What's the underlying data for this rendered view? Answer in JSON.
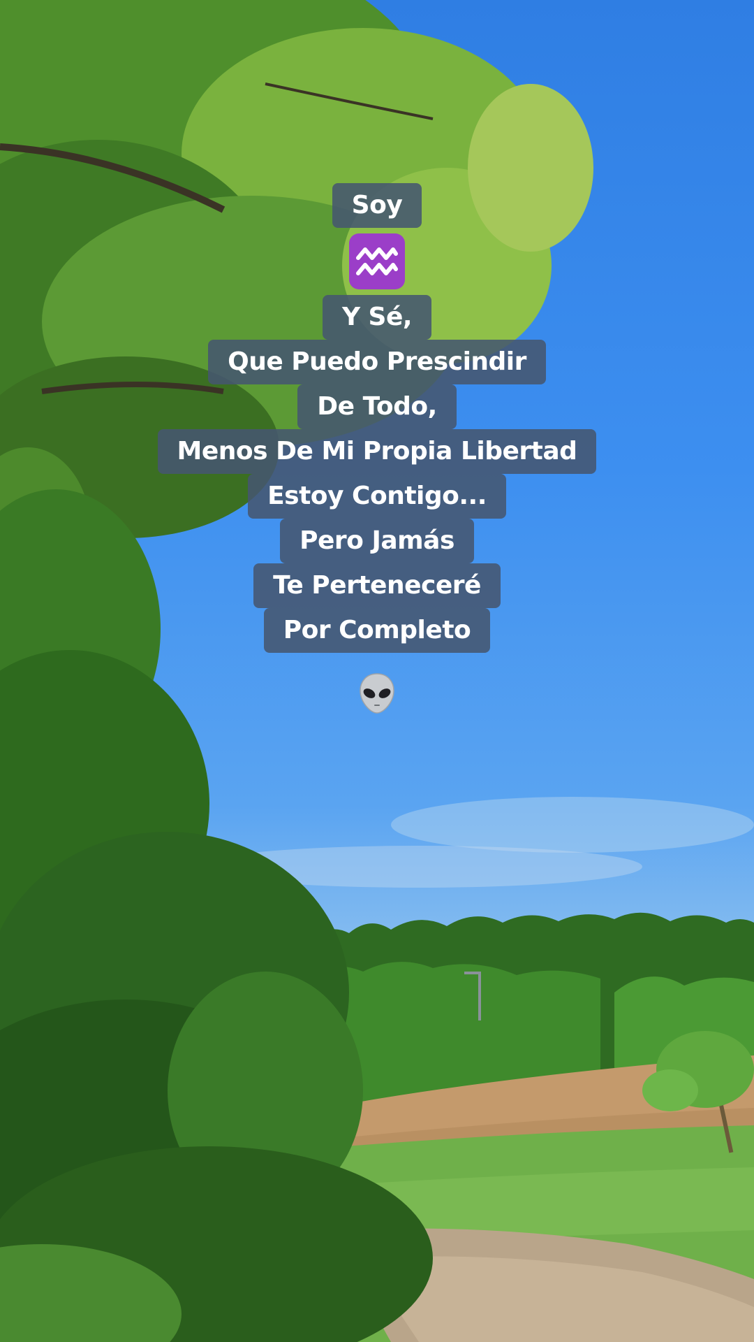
{
  "caption": {
    "lines": [
      "Soy",
      "Y Sé,",
      "Que Puedo Prescindir",
      "De Todo,",
      "Menos De Mi Propia Libertad",
      "Estoy Contigo...",
      "Pero Jamás",
      "Te Perteneceré",
      "Por Completo"
    ],
    "zodiac_icon": "aquarius-icon",
    "end_icon": "alien-icon"
  },
  "colors": {
    "caption_background": "#465670",
    "caption_text": "#ffffff",
    "aquarius_badge": "#9b3ec8",
    "sky": "#3d8ff0"
  }
}
